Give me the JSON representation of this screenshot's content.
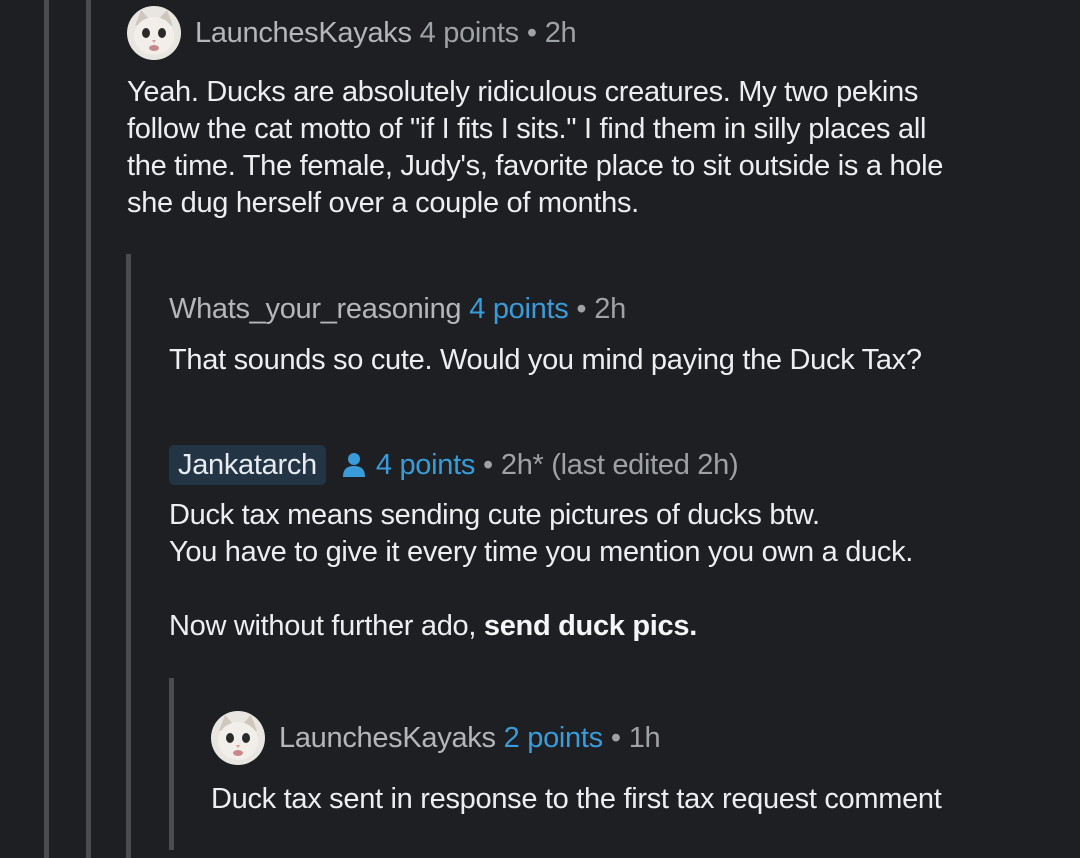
{
  "comments": [
    {
      "author": "LaunchesKayaks",
      "points": "4 points",
      "separator": "•",
      "time": "2h",
      "avatar_icon": "cat-avatar-icon",
      "body": [
        "Yeah. Ducks are absolutely ridiculous creatures. My two pekins",
        "follow the cat motto of \"if I fits I sits.\" I find them in silly places all",
        "the time. The female, Judy's, favorite place to sit outside is a hole",
        "she dug herself over a couple of months."
      ]
    },
    {
      "author": "Whats_your_reasoning",
      "points": "4 points",
      "separator": "•",
      "time": "2h",
      "body": [
        "That sounds so cute. Would you mind paying the Duck Tax?"
      ]
    },
    {
      "author": "Jankatarch",
      "author_icon": "user-icon",
      "points": "4 points",
      "separator": "•",
      "time": "2h* (last edited 2h)",
      "body": [
        "Duck tax means sending cute pictures of ducks btw.",
        "You have to give it every time you mention you own a duck."
      ],
      "body_para2_prefix": "Now without further ado, ",
      "body_para2_bold": "send duck pics."
    },
    {
      "author": "LaunchesKayaks",
      "points": "2 points",
      "separator": "•",
      "time": "1h",
      "avatar_icon": "cat-avatar-icon",
      "body": [
        "Duck tax sent in response to the first tax request comment"
      ]
    }
  ],
  "colors": {
    "background": "#1d1f22",
    "thread_line": "#4a4c50",
    "points_accent": "#3a9bd9",
    "op_badge": "#233444"
  }
}
